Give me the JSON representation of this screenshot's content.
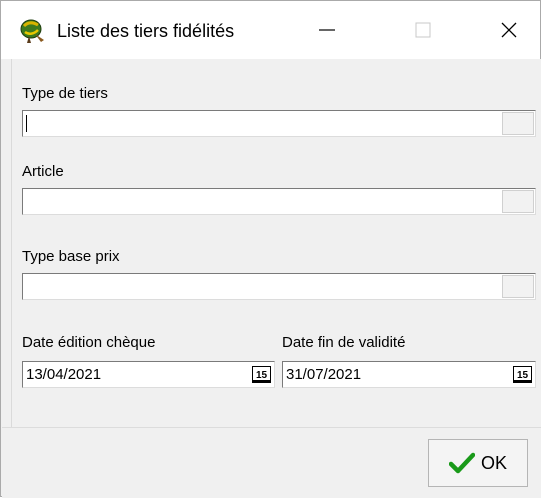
{
  "window": {
    "title": "Liste des tiers fidélités",
    "icon": "fidelity-app-icon",
    "controls": [
      "minimize-icon",
      "maximize-icon",
      "close-icon"
    ]
  },
  "form": {
    "type_tiers": {
      "label": "Type de tiers",
      "value": ""
    },
    "article": {
      "label": "Article",
      "value": ""
    },
    "type_base_prix": {
      "label": "Type base prix",
      "value": ""
    },
    "date_edition": {
      "label": "Date édition chèque",
      "value": "13/04/2021",
      "button_text": "15"
    },
    "date_fin": {
      "label": "Date fin de validité",
      "value": "31/07/2021",
      "button_text": "15"
    }
  },
  "footer": {
    "ok_label": "OK",
    "ok_icon": "checkmark-icon",
    "ok_icon_color": "#1a9a1a"
  }
}
